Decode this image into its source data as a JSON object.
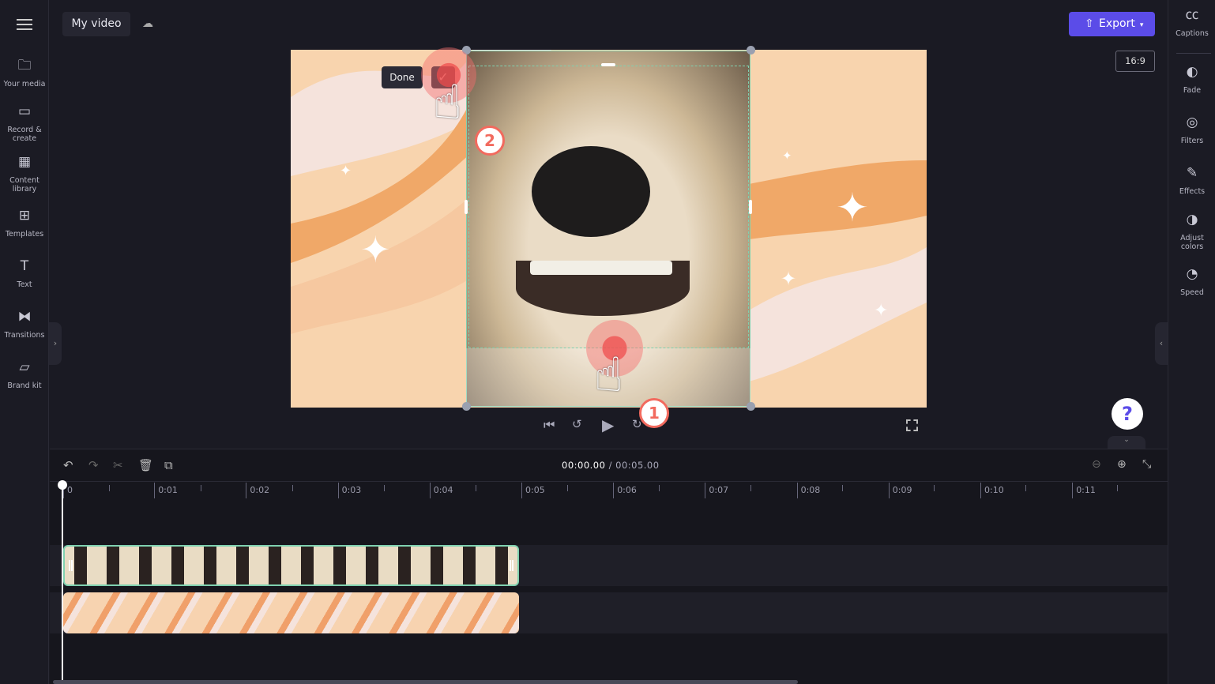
{
  "header": {
    "title": "My video",
    "export_label": "Export",
    "aspect_ratio": "16:9"
  },
  "sidebar": {
    "items": [
      {
        "label": "Your media",
        "icon": "folder-icon"
      },
      {
        "label": "Record &\ncreate",
        "icon": "camera-icon"
      },
      {
        "label": "Content\nlibrary",
        "icon": "library-icon"
      },
      {
        "label": "Templates",
        "icon": "templates-icon"
      },
      {
        "label": "Text",
        "icon": "text-icon"
      },
      {
        "label": "Transitions",
        "icon": "transitions-icon"
      },
      {
        "label": "Brand kit",
        "icon": "brand-kit-icon"
      }
    ]
  },
  "rightbar": {
    "items": [
      {
        "label": "Captions",
        "icon": "captions-icon"
      },
      {
        "label": "Fade",
        "icon": "fade-icon"
      },
      {
        "label": "Filters",
        "icon": "filters-icon"
      },
      {
        "label": "Effects",
        "icon": "effects-icon"
      },
      {
        "label": "Adjust\ncolors",
        "icon": "adjust-colors-icon"
      },
      {
        "label": "Speed",
        "icon": "speed-icon"
      }
    ]
  },
  "crop": {
    "done_label": "Done"
  },
  "steps": [
    "1",
    "2"
  ],
  "playback": {
    "current": "00:00.00",
    "total": "/ 00:05.00"
  },
  "ruler": [
    "0",
    "0:01",
    "0:02",
    "0:03",
    "0:04",
    "0:05",
    "0:06",
    "0:07",
    "0:08",
    "0:09",
    "0:10",
    "0:11"
  ],
  "help_label": "?",
  "colors": {
    "accent": "#5b4ce8",
    "crop_border": "#7fd1b0",
    "tap": "#f26a5e",
    "background": "#f8d4ae"
  }
}
